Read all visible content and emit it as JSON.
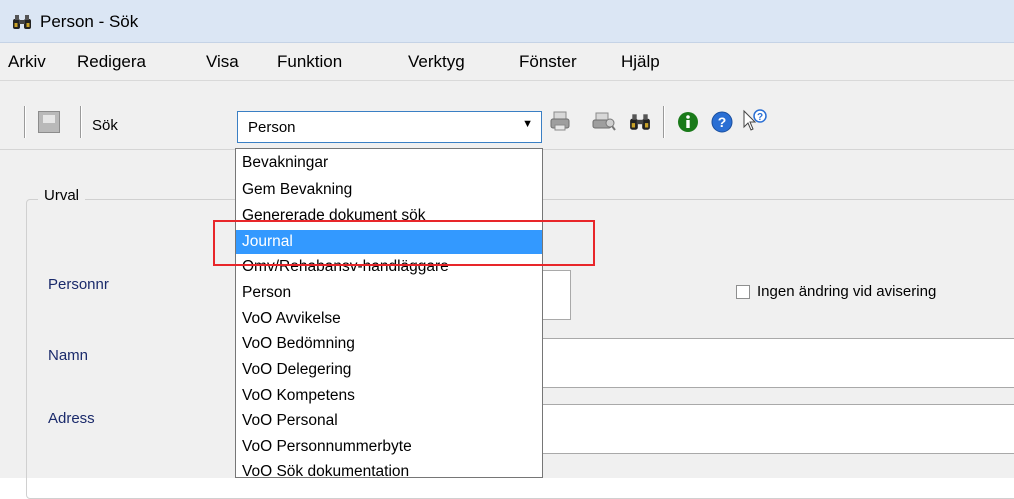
{
  "window": {
    "title": "Person - Sök",
    "icon": "binoculars-icon"
  },
  "menu": [
    "Arkiv",
    "Redigera",
    "Visa",
    "Funktion",
    "Verktyg",
    "Fönster",
    "Hjälp"
  ],
  "toolbar": {
    "search_label": "Sök",
    "combo_value": "Person",
    "icons": [
      "save-icon",
      "print-icon",
      "print-preview-icon",
      "binoculars-icon",
      "info-icon",
      "help-icon",
      "whats-this-icon"
    ]
  },
  "dropdown": {
    "selected": "Journal",
    "items": [
      "Bevakningar",
      "Gem Bevakning",
      "Genererade dokument sök",
      "Journal",
      "Omv/Rehabansv-handläggare",
      "Person",
      "VoO Avvikelse",
      "VoO Bedömning",
      "VoO Delegering",
      "VoO Kompetens",
      "VoO Personal",
      "VoO Personnummerbyte",
      "VoO Sök dokumentation"
    ]
  },
  "form": {
    "group_title": "Urval",
    "labels": {
      "personnr": "Personnr",
      "namn": "Namn",
      "adress": "Adress"
    },
    "checkbox_label": "Ingen ändring vid avisering"
  },
  "colors": {
    "highlight": "#3399ff",
    "annotation": "#e8262a",
    "info_icon": "#1a7a1a",
    "help_icon": "#2a6fd4"
  }
}
